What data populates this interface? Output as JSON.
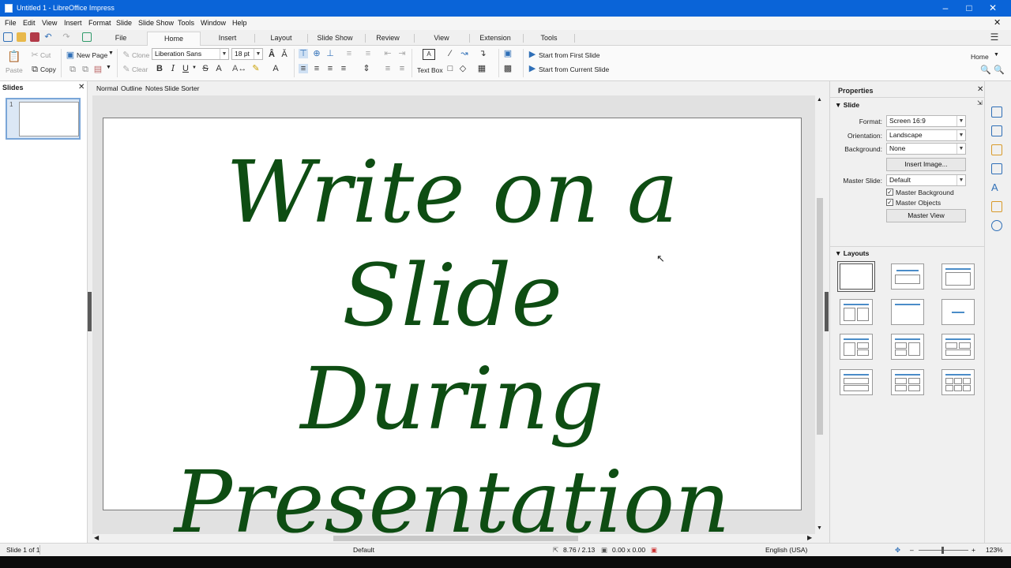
{
  "window": {
    "title": "Untitled 1 - LibreOffice Impress"
  },
  "menu": [
    "File",
    "Edit",
    "View",
    "Insert",
    "Format",
    "Slide",
    "Slide Show",
    "Tools",
    "Window",
    "Help"
  ],
  "tabs": [
    "File",
    "Home",
    "Insert",
    "Layout",
    "Slide Show",
    "Review",
    "View",
    "Extension",
    "Tools"
  ],
  "active_tab": "Home",
  "ribbon": {
    "paste": "Paste",
    "cut": "Cut",
    "copy": "Copy",
    "new_page": "New Page",
    "clone": "Clone",
    "clear": "Clear",
    "font_name": "Liberation Sans",
    "font_size": "18 pt",
    "text_box": "Text Box",
    "start_first": "Start from First Slide",
    "start_current": "Start from Current Slide",
    "home_label": "Home"
  },
  "slides_panel": {
    "title": "Slides",
    "thumb_number": "1"
  },
  "view_tabs": [
    "Normal",
    "Outline",
    "Notes",
    "Slide Sorter"
  ],
  "slide": {
    "title_text": "Write on a Slide\nDuring\nPresentation",
    "title_color": "#0e4d13"
  },
  "properties": {
    "title": "Properties",
    "slide_section": "Slide",
    "format_label": "Format:",
    "format_value": "Screen 16:9",
    "orientation_label": "Orientation:",
    "orientation_value": "Landscape",
    "background_label": "Background:",
    "background_value": "None",
    "insert_image": "Insert Image...",
    "master_slide_label": "Master Slide:",
    "master_slide_value": "Default",
    "master_background": "Master Background",
    "master_objects": "Master Objects",
    "master_view": "Master View",
    "layouts_section": "Layouts"
  },
  "status": {
    "slide_pos": "Slide 1 of 1",
    "master": "Default",
    "position": "8.76 / 2.13",
    "size": "0.00 x 0.00",
    "language": "English (USA)",
    "zoom": "123%"
  },
  "icons": [
    "save-icon",
    "undo-icon",
    "redo-icon",
    "cut-icon",
    "copy-icon",
    "bold-icon",
    "italic-icon",
    "underline-icon",
    "strikethrough-icon",
    "align-left-icon",
    "align-center-icon",
    "align-right-icon",
    "justify-icon",
    "sidebar-menu-icon",
    "close-icon"
  ]
}
